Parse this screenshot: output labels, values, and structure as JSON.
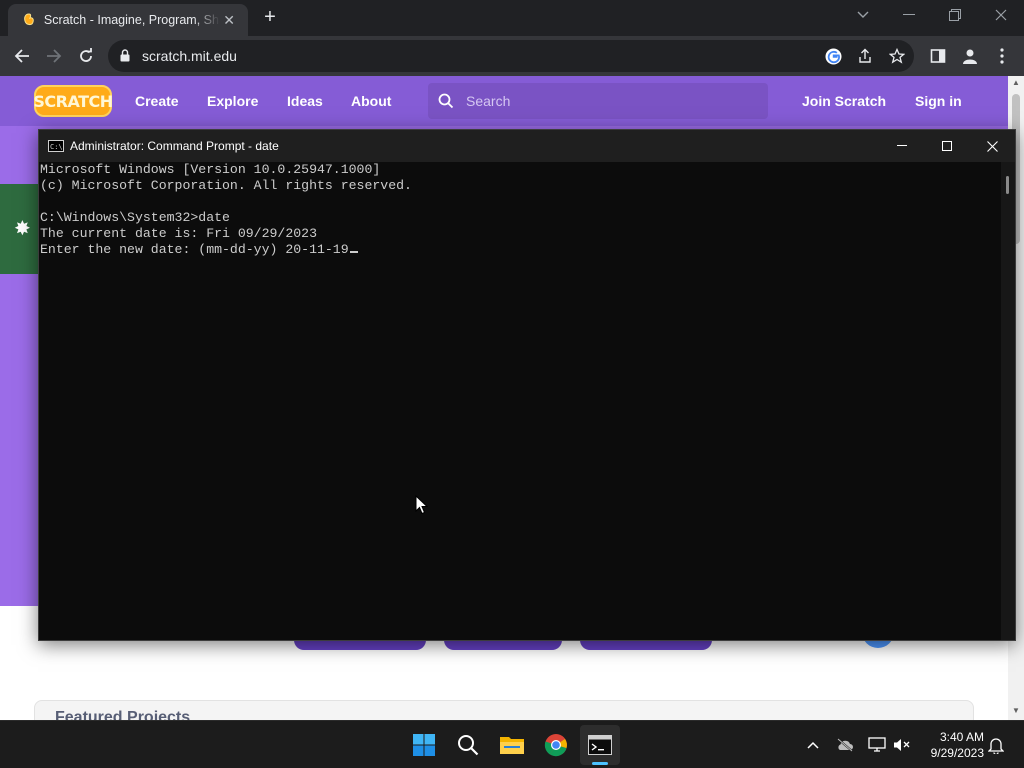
{
  "browser": {
    "tab": {
      "title": "Scratch - Imagine, Program, Share",
      "close": "✕"
    },
    "new_tab": "+",
    "url": "scratch.mit.edu"
  },
  "scratch": {
    "logo": "SCRATCH",
    "nav": [
      "Create",
      "Explore",
      "Ideas",
      "About"
    ],
    "search_placeholder": "Search",
    "join": "Join Scratch",
    "sign_in": "Sign in",
    "featured_title": "Featured Projects"
  },
  "cmd": {
    "title": "Administrator: Command Prompt - date",
    "lines": [
      "Microsoft Windows [Version 10.0.25947.1000]",
      "(c) Microsoft Corporation. All rights reserved.",
      "",
      "C:\\Windows\\System32>date",
      "The current date is: Fri 09/29/2023",
      "Enter the new date: (mm-dd-yy) 20-11-19"
    ]
  },
  "taskbar": {
    "time": "3:40 AM",
    "date": "9/29/2023"
  },
  "colors": {
    "scratch_purple": "#855cd6",
    "cmd_bg": "#0c0c0c",
    "taskbar_bg": "#1c1c1c"
  }
}
